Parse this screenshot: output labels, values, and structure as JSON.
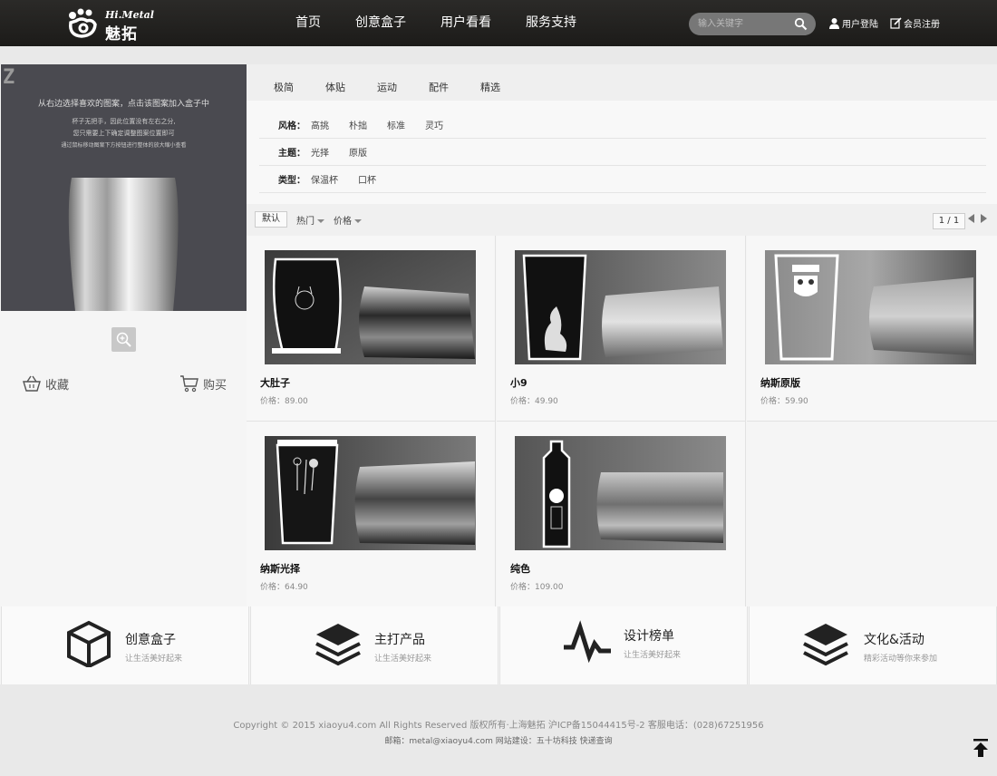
{
  "header": {
    "logo_en": "Hi.Metal",
    "logo_cn": "魅拓",
    "nav": [
      "首页",
      "创意盒子",
      "用户看看",
      "服务支持"
    ],
    "search_placeholder": "输入关键字",
    "login_label": "用户登陆",
    "register_label": "会员注册"
  },
  "preview": {
    "corner_mark": "Z",
    "instruction": "从右边选择喜欢的图案，点击该图案加入盒子中",
    "note1": "杯子无把手，因此位置没有左右之分,",
    "note2": "您只需要上下确定调整图案位置即可",
    "note3": "通过鼠标移动图案下方按钮进行整体的放大缩小查看",
    "favorite_label": "收藏",
    "buy_label": "购买"
  },
  "tabs": [
    "极简",
    "体贴",
    "运动",
    "配件",
    "精选"
  ],
  "filters": [
    {
      "key": "风格：",
      "values": [
        "高挑",
        "朴拙",
        "标准",
        "灵巧"
      ]
    },
    {
      "key": "主题：",
      "values": [
        "光择",
        "原版"
      ]
    },
    {
      "key": "类型：",
      "values": [
        "保温杯",
        "口杯"
      ]
    }
  ],
  "sort": {
    "default_label": "默认",
    "hot_label": "热门",
    "price_label": "价格",
    "pager": "1 / 1"
  },
  "products": [
    {
      "name": "大肚子",
      "price": "价格：89.00"
    },
    {
      "name": "小9",
      "price": "价格：49.90"
    },
    {
      "name": "纳斯原版",
      "price": "价格：59.90"
    },
    {
      "name": "纳斯光择",
      "price": "价格：64.90"
    },
    {
      "name": "纯色",
      "price": "价格：109.00"
    }
  ],
  "features": [
    {
      "title": "创意盒子",
      "subtitle": "让生活美好起来",
      "icon": "box-icon"
    },
    {
      "title": "主打产品",
      "subtitle": "让生活美好起来",
      "icon": "layers-icon"
    },
    {
      "title": "设计榜单",
      "subtitle": "让生活美好起来",
      "icon": "pulse-icon"
    },
    {
      "title": "文化&活动",
      "subtitle": "精彩活动等你来参加",
      "icon": "layers-icon"
    }
  ],
  "footer": {
    "line1": "Copyright © 2015 xiaoyu4.com All Rights Reserved   版权所有·上海魅拓   沪ICP备15044415号-2 客服电话：(028)67251956",
    "line2": "邮箱：metal@xiaoyu4.com 网站建设：五十坊科技 快递查询"
  },
  "colors": {
    "header_bg": "#1c1b19",
    "preview_bg": "#4a4a50",
    "accent": "#222222"
  }
}
